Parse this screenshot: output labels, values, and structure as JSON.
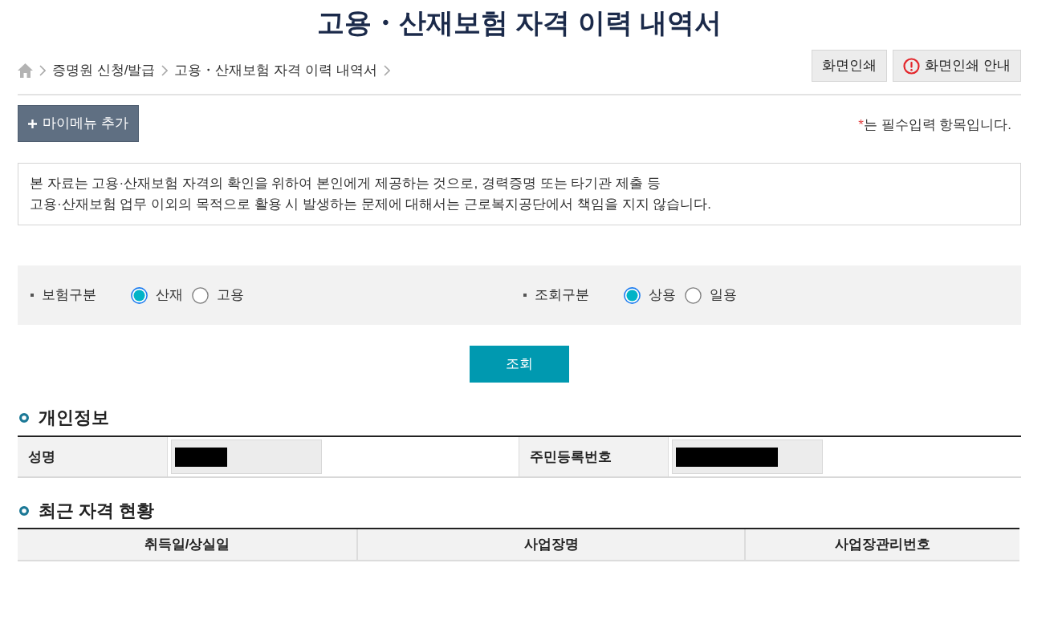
{
  "page_title": "고용・산재보험 자격 이력 내역서",
  "breadcrumb": [
    "증명원 신청/발급",
    "고용・산재보험 자격 이력 내역서"
  ],
  "print_buttons": [
    {
      "kind": "plain",
      "label": "화면인쇄"
    },
    {
      "kind": "info",
      "label": "화면인쇄 안내"
    }
  ],
  "mymenu_button": {
    "label": "마이메뉴 추가"
  },
  "required_note": {
    "mark": "*",
    "text": "는 필수입력 항목입니다."
  },
  "notice": {
    "lines": [
      "본 자료는 고용·산재보험 자격의 확인을 위하여 본인에게 제공하는 것으로, 경력증명 또는 타기관 제출 등",
      "고용·산재보험 업무 이외의 목적으로 활용 시 발생하는 문제에 대해서는 근로복지공단에서 책임을 지지 않습니다."
    ]
  },
  "filters": [
    {
      "label": "보험구분",
      "options": [
        {
          "label": "산재",
          "selected": true
        },
        {
          "label": "고용",
          "selected": false
        }
      ]
    },
    {
      "label": "조회구분",
      "options": [
        {
          "label": "상용",
          "selected": true
        },
        {
          "label": "일용",
          "selected": false
        }
      ]
    }
  ],
  "search_button": {
    "label": "조회"
  },
  "personal_info": {
    "title": "개인정보",
    "fields": [
      {
        "label": "성명",
        "redacted": true
      },
      {
        "label": "주민등록번호",
        "redacted": true
      }
    ]
  },
  "qualification_status": {
    "title": "최근 자격 현황",
    "columns": [
      "취득일/상실일",
      "사업장명",
      "사업장관리번호"
    ]
  }
}
